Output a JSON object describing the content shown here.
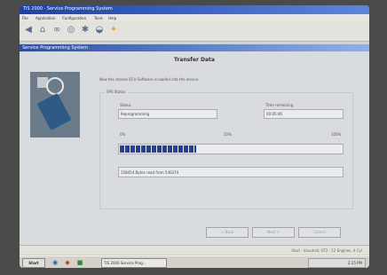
{
  "window": {
    "title": "TIS 2000 · Service Programming System"
  },
  "menubar": {
    "items": [
      "File",
      "Application",
      "Configuration",
      "Tools",
      "Help"
    ]
  },
  "toolbar": {
    "icons": [
      "back-icon",
      "home-icon",
      "binoculars-icon",
      "disc-icon",
      "settings-icon",
      "car-icon",
      "lightbulb-icon"
    ]
  },
  "app": {
    "title": "Service Programming System"
  },
  "dialog": {
    "heading": "Transfer Data",
    "instruction": "Now the chosen ECU Software is loaded into the device.",
    "group_label": "SPS Status",
    "status_label": "Status",
    "status_value": "Reprogramming",
    "time_label": "Time remaining",
    "time_value": "00:05:46",
    "percent_0": "0%",
    "percent_50": "50%",
    "percent_100": "100%",
    "progress": 0.34,
    "message": "158454 Bytes read from 540374"
  },
  "buttons": {
    "back": "< Back",
    "next": "Next >",
    "cancel": "Cancel"
  },
  "statusbar": {
    "text": "Start · Vauxhall, GT2 · 12 Engines, 4 Cyl"
  },
  "taskbar": {
    "start": "Start",
    "task": "TIS 2000 Service Prog...",
    "clock": "2:15 PM"
  }
}
